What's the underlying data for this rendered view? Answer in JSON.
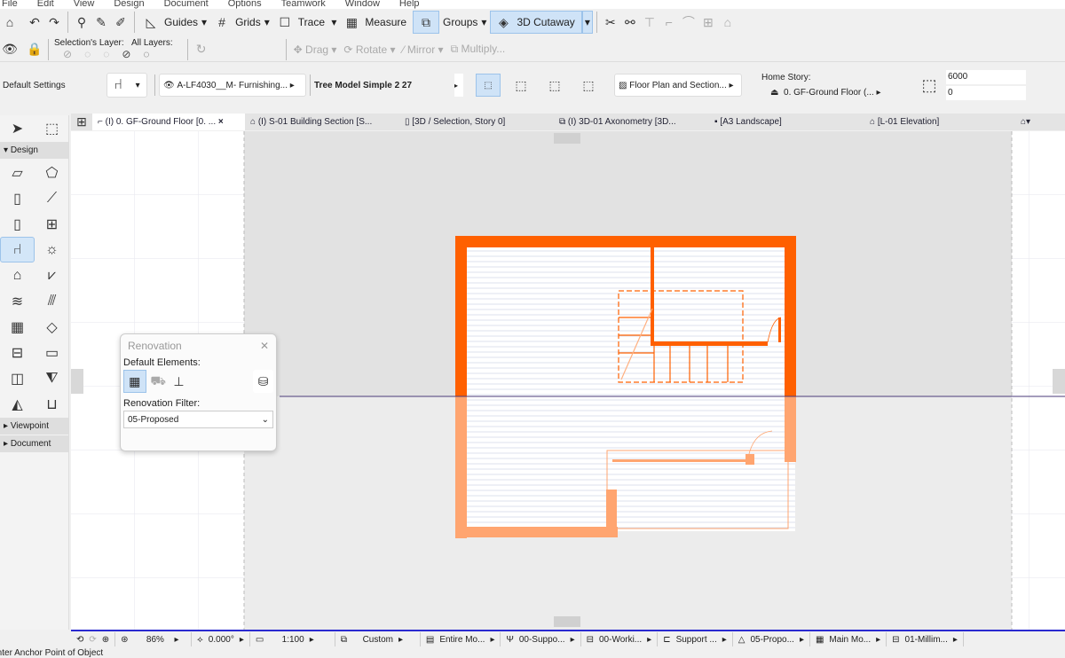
{
  "menu": [
    "File",
    "Edit",
    "View",
    "Design",
    "Document",
    "Options",
    "Teamwork",
    "Window",
    "Help"
  ],
  "toolbar1": {
    "guides": "Guides",
    "grids": "Grids",
    "trace": "Trace",
    "measure": "Measure",
    "groups": "Groups",
    "cutaway": "3D Cutaway"
  },
  "toolbar2": {
    "selection_layer": "Selection's Layer:",
    "all_layers": "All Layers:",
    "drag": "Drag",
    "rotate": "Rotate",
    "mirror": "Mirror",
    "multiply": "Multiply..."
  },
  "infobox": {
    "default_settings": "Default Settings",
    "layer": "A-LF4030__M- Furnishing...",
    "object_name": "Tree Model Simple 2 27",
    "floor_plan": "Floor Plan and Section...",
    "home_story_label": "Home Story:",
    "home_story": "0. GF-Ground Floor (...",
    "height": "6000",
    "offset": "0"
  },
  "tabs": [
    {
      "label": "(I) 0. GF-Ground Floor [0. ...",
      "active": true
    },
    {
      "label": "(I) S-01 Building Section [S..."
    },
    {
      "label": "[3D / Selection, Story 0]"
    },
    {
      "label": "(I) 3D-01 Axonometry [3D..."
    },
    {
      "label": "[A3 Landscape]"
    },
    {
      "label": "[L-01 Elevation]"
    }
  ],
  "toolbox": {
    "design": "Design",
    "viewpoint": "Viewpoint",
    "document": "Document"
  },
  "renovation": {
    "title": "Renovation",
    "default_elements": "Default Elements:",
    "filter_label": "Renovation Filter:",
    "filter_value": "05-Proposed"
  },
  "status": {
    "zoom": "86%",
    "angle": "0.000°",
    "scale": "1:100",
    "pen_set": "Custom",
    "model_view": "Entire Mo...",
    "layer_combo": "00-Suppo...",
    "graphic_override": "00-Worki...",
    "structure": "Support ...",
    "renovation": "05-Propo...",
    "mvo": "Main Mo...",
    "dimension": "01-Millim..."
  },
  "prompt": "Enter Anchor Point of Object",
  "colors": {
    "accent": "#ff6000",
    "accent_light": "#ffa570",
    "selected": "#cfe3f7"
  }
}
